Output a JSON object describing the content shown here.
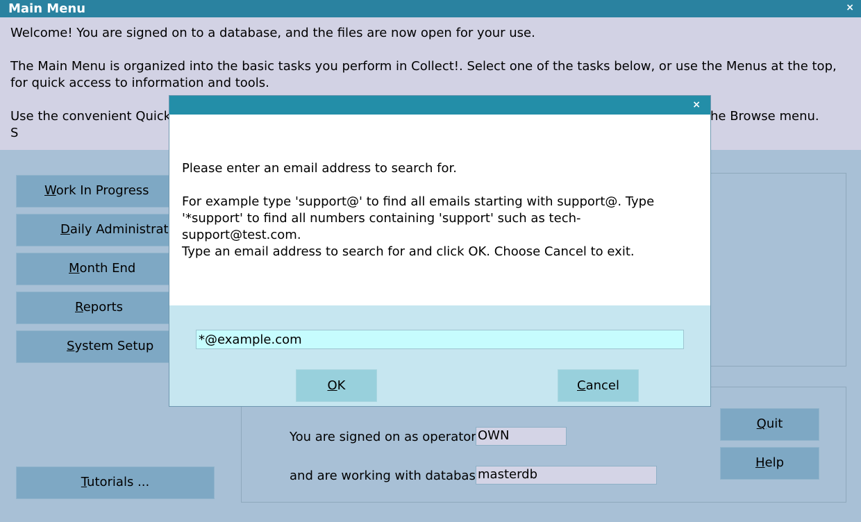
{
  "window": {
    "title": "Main Menu",
    "close_glyph": "×"
  },
  "intro": {
    "line1": "Welcome! You are signed on to a database, and the files are now open for your use.",
    "line2": "The Main Menu is organized into the basic tasks you perform in Collect!. Select one of the tasks below, or use the Menus at the top, for quick access to information and tools.",
    "line3_start": "Use the convenient Quick S",
    "line3_end": "he Browse menu."
  },
  "menu": {
    "work_in_progress": {
      "accel": "W",
      "rest": "ork In Progress"
    },
    "daily_admin": {
      "accel": "D",
      "rest": "aily Administration"
    },
    "month_end": {
      "accel": "M",
      "rest": "onth End"
    },
    "reports": {
      "accel": "R",
      "rest": "eports"
    },
    "system_setup": {
      "accel": "S",
      "rest": "ystem Setup"
    },
    "tutorials": {
      "accel": "T",
      "rest": "utorials ..."
    }
  },
  "status": {
    "operator_label": "You are signed on as operator",
    "operator_value": "OWN",
    "database_label": "and are working with database",
    "database_value": "masterdb"
  },
  "side_buttons": {
    "quit": {
      "accel": "Q",
      "rest": "uit"
    },
    "help": {
      "accel": "H",
      "rest": "elp"
    }
  },
  "dialog": {
    "close_glyph": "×",
    "prompt": "Please enter an email address to search for.",
    "example": "For example type 'support@' to find all emails starting with support@. Type '*support' to find all numbers containing 'support' such as tech-support@test.com.",
    "instruction": "Type an email address to search for and click OK. Choose Cancel to exit.",
    "input_value": "*@example.com",
    "ok": {
      "accel": "O",
      "rest": "K"
    },
    "cancel": {
      "accel": "C",
      "rest": "ancel"
    }
  }
}
